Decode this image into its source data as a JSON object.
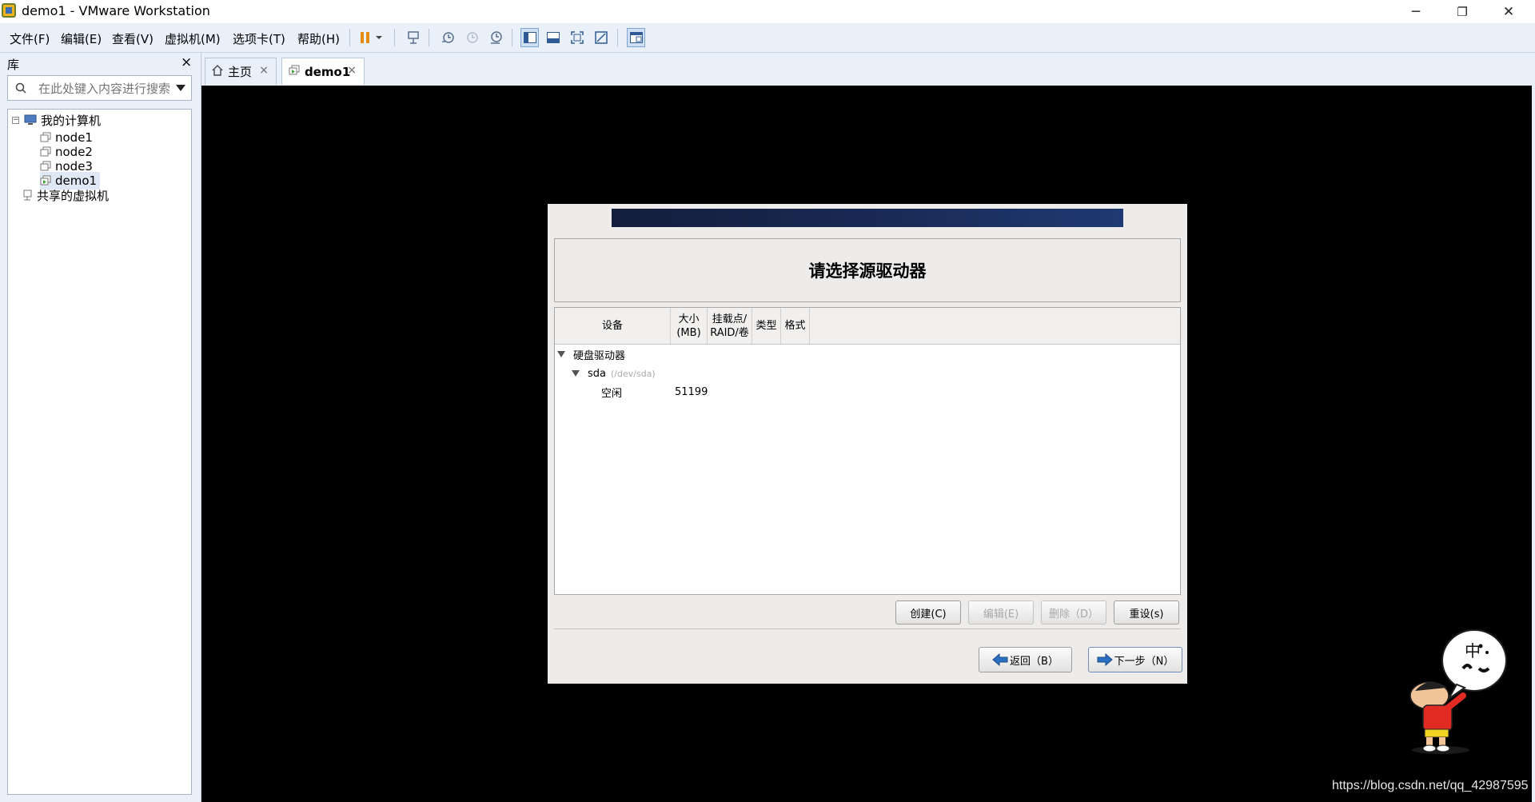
{
  "window": {
    "title": "demo1 - VMware Workstation",
    "controls": {
      "minimize": "─",
      "restore": "❐",
      "close": "✕"
    }
  },
  "menu": [
    {
      "label": "文件(F)"
    },
    {
      "label": "编辑(E)"
    },
    {
      "label": "查看(V)"
    },
    {
      "label": "虚拟机(M)"
    },
    {
      "label": "选项卡(T)"
    },
    {
      "label": "帮助(H)"
    }
  ],
  "toolbar_icons": [
    "pause-icon",
    "dropdown-icon",
    "send-keys-icon",
    "snapshot-icon",
    "revert-snapshot-icon",
    "snapshot-manager-icon",
    "library-view-icon",
    "thumbnail-view-icon",
    "fullscreen-icon",
    "unity-icon",
    "console-view-icon"
  ],
  "library": {
    "title": "库",
    "close": "×",
    "search_placeholder": "在此处键入内容进行搜索",
    "tree": {
      "root": "我的计算机",
      "root_toggle": "−",
      "vms": [
        "node1",
        "node2",
        "node3",
        "demo1"
      ],
      "selected": "demo1",
      "shared": "共享的虚拟机"
    }
  },
  "tabs": [
    {
      "label": "主页",
      "close": "×"
    },
    {
      "label": "demo1",
      "close": "×"
    }
  ],
  "installer": {
    "heading": "请选择源驱动器",
    "columns": {
      "device": "设备",
      "size": "大小\n(MB)",
      "mount": "挂载点/\nRAID/卷",
      "type": "类型",
      "format": "格式"
    },
    "rows": {
      "group": "硬盘驱动器",
      "disk": "sda",
      "disk_path": "(/dev/sda)",
      "free_label": "空闲",
      "free_size": "51199"
    },
    "buttons": {
      "create": "创建(C)",
      "edit": "编辑(E)",
      "delete": "删除（D）",
      "reset": "重设(s)",
      "back": "返回（B）",
      "next": "下一步（N）"
    }
  },
  "sticker_text": "中",
  "watermark": "https://blog.csdn.net/qq_42987595",
  "colors": {
    "chrome_bg": "#e9f0fa",
    "vm_bg": "#000000",
    "installer_bg": "#edeceb",
    "banner": "#1a2a56",
    "accent_arrow": "#2a6fc0"
  }
}
